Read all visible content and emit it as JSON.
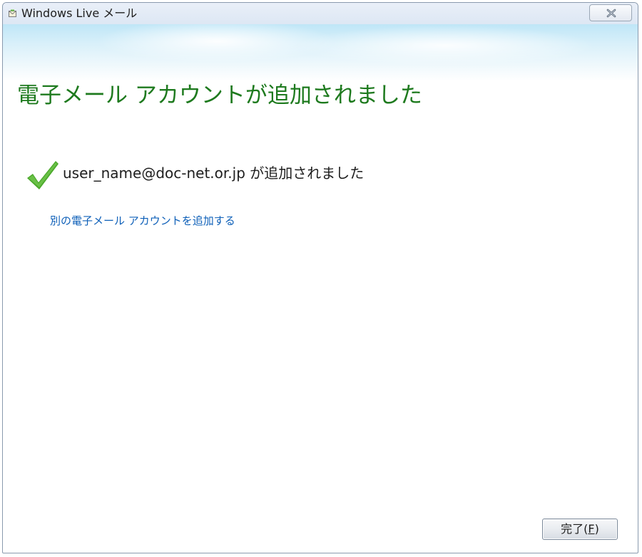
{
  "window": {
    "title": "Windows Live メール"
  },
  "heading": "電子メール アカウントが追加されました",
  "status": {
    "email": "user_name@doc-net.or.jp",
    "suffix": "が追加されました"
  },
  "links": {
    "add_another": "別の電子メール アカウントを追加する"
  },
  "buttons": {
    "finish_prefix": "完了(",
    "finish_mnemonic": "F",
    "finish_suffix": ")"
  },
  "colors": {
    "heading": "#1e7a1e",
    "link": "#0d5fb8",
    "check": "#4aa82a"
  },
  "icons": {
    "app": "windows-live-mail-icon",
    "close": "close-icon",
    "success": "checkmark-icon"
  }
}
